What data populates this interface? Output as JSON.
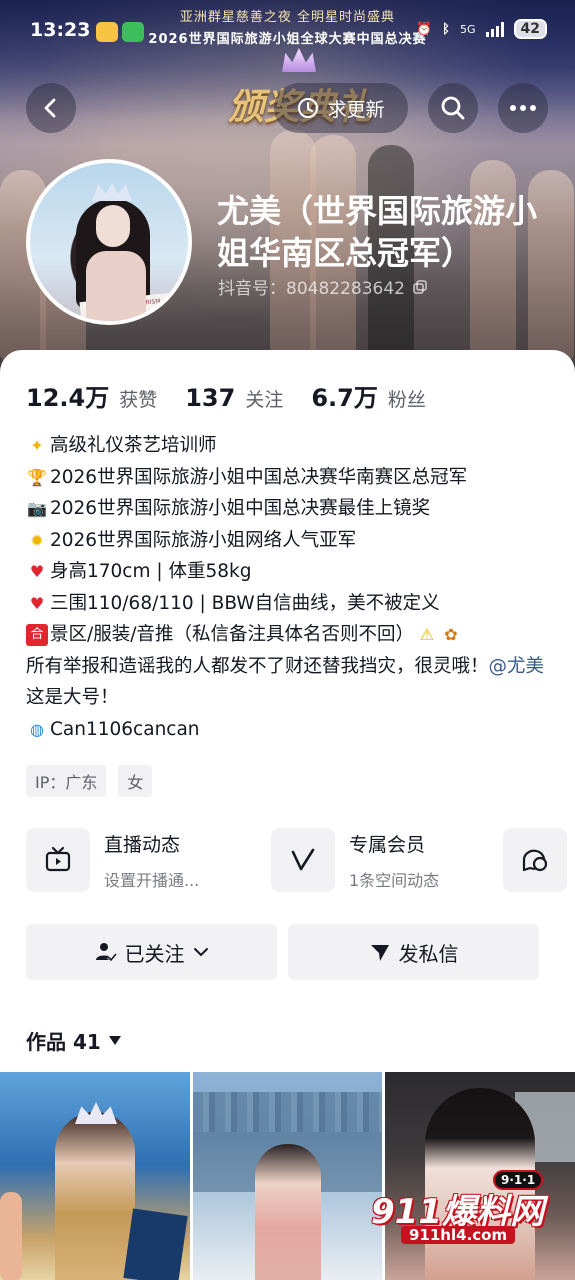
{
  "status_bar": {
    "time": "13:23",
    "network": "5G",
    "battery": "42",
    "app_icons": [
      "weibo-icon",
      "wechat-icon"
    ]
  },
  "banner": {
    "line1": "亚洲群星慈善之夜 全明星时尚盛典",
    "line2": "2026世界国际旅游小姐全球大赛中国总决赛",
    "award_text": "颁奖典礼"
  },
  "nav": {
    "request_update_label": "求更新"
  },
  "profile": {
    "name": "尤美（世界国际旅游小姐华南区总冠军）",
    "douyin_id": "抖音号：80482283642",
    "avatar_sash": "2026 MISS TOURISM WORLDWIDE"
  },
  "stats": [
    {
      "num": "12.4万",
      "label": "获赞"
    },
    {
      "num": "137",
      "label": "关注"
    },
    {
      "num": "6.7万",
      "label": "粉丝"
    }
  ],
  "bio": {
    "line1": "高级礼仪茶艺培训师",
    "line2": "2026世界国际旅游小姐中国总决赛华南赛区总冠军",
    "line3": "2026世界国际旅游小姐中国总决赛最佳上镜奖",
    "line4": "2026世界国际旅游小姐网络人气亚军",
    "line5": "身高170cm | 体重58kg",
    "line6": "三围110/68/110 | BBW自信曲线，美不被定义",
    "line7": "景区/服装/音推（私信备注具体名否则不回）",
    "line8a": "所有举报和造谣我的人都发不了财还替我挡灾，很灵哦！",
    "mention": "@尤美",
    "line8b": " 这是大号！",
    "line9": "Can1106cancan"
  },
  "tags": [
    "IP：广东",
    "女"
  ],
  "features": [
    {
      "title": "直播动态",
      "subtitle": "设置开播通...",
      "icon": "live-tv-icon"
    },
    {
      "title": "专属会员",
      "subtitle": "1条空间动态",
      "icon": "v-member-icon"
    },
    {
      "icon": "chat-bubble-icon"
    }
  ],
  "actions": {
    "following_label": "已关注",
    "message_label": "发私信"
  },
  "works": {
    "label": "作品 41"
  },
  "watermark": {
    "big": "911爆料网",
    "small": "911hl4.com",
    "badge": "9·1·1"
  },
  "colors": {
    "text_primary": "#161823",
    "text_secondary": "#5f6068",
    "button_bg": "#f2f2f4",
    "mention": "#3a5a8c"
  }
}
